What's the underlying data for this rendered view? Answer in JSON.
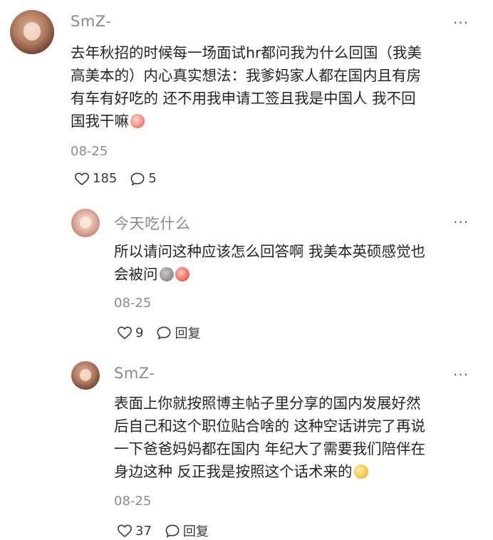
{
  "comments": [
    {
      "username": "SmZ-",
      "text": "去年秋招的时候每一场面试hr都问我为什么回国（我美高美本的）内心真实想法：我爹妈家人都在国内且有房有车有好吃的 还不用我申请工签且我是中国人 我不回国我干嘛",
      "lines": [
        "去年秋招的时候每一场面试hr都问我为什么回国（我美",
        "高美本的）内心真实想法：我爹妈家人都在国内且有房",
        "有车有好吃的 还不用我申请工签且我是中国人 我不回",
        "国我干嘛"
      ],
      "date": "08-25",
      "likes": "185",
      "replies": "5",
      "more": "···"
    },
    {
      "username": "今天吃什么",
      "lines": [
        "所以请问这种应该怎么回答啊 我美本英硕感觉也",
        "会被问"
      ],
      "date": "08-25",
      "likes": "9",
      "reply_label": "回复",
      "more": "···"
    },
    {
      "username": "SmZ-",
      "lines": [
        "表面上你就按照博主帖子里分享的国内发展好然",
        "后自己和这个职位贴合啥的 这种空话讲完了再说",
        "一下爸爸妈妈都在国内 年纪大了需要我们陪伴在",
        "身边这种 反正我是按照这个话术来的"
      ],
      "date": "08-25",
      "likes": "37",
      "reply_label": "回复",
      "more": "···"
    }
  ]
}
